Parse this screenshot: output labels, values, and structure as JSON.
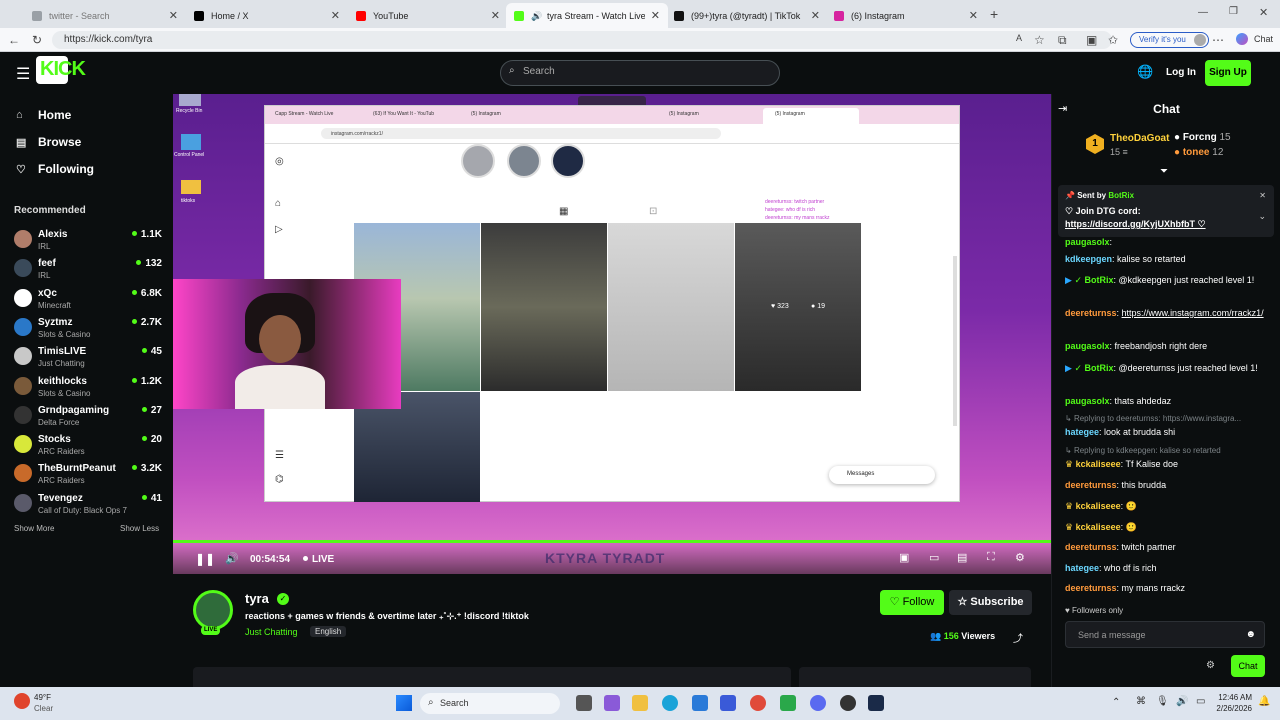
{
  "browser": {
    "tabs": [
      {
        "label": "twitter - Search",
        "color": "#9aa0a6"
      },
      {
        "label": "Home / X",
        "color": "#000000"
      },
      {
        "label": "YouTube",
        "color": "#ff0000"
      },
      {
        "label": "tyra Stream - Watch Live on K",
        "color": "#53fc18"
      },
      {
        "label": "(99+)tyra (@tyradt) | TikTok",
        "color": "#111111"
      },
      {
        "label": "(6) Instagram",
        "color": "#d6249f"
      }
    ],
    "url": "https://kick.com/tyra",
    "verify_label": "Verify it's you",
    "chat_label": "Chat"
  },
  "header": {
    "logo": "KICK",
    "search_placeholder": "Search",
    "login": "Log In",
    "signup": "Sign Up"
  },
  "sidebar": {
    "nav": [
      {
        "label": "Home",
        "icon": "home-icon"
      },
      {
        "label": "Browse",
        "icon": "browse-icon"
      },
      {
        "label": "Following",
        "icon": "heart-icon"
      }
    ],
    "recommended_title": "Recommended",
    "channels": [
      {
        "name": "Alexis",
        "category": "IRL",
        "viewers": "1.1K",
        "color": "#b07d6a"
      },
      {
        "name": "feef",
        "category": "IRL",
        "viewers": "132",
        "color": "#3a4a5a"
      },
      {
        "name": "xQc",
        "category": "Minecraft",
        "viewers": "6.8K",
        "color": "#ffffff"
      },
      {
        "name": "Syztmz",
        "category": "Slots & Casino",
        "viewers": "2.7K",
        "color": "#2a78c8"
      },
      {
        "name": "TimisLIVE",
        "category": "Just Chatting",
        "viewers": "45",
        "color": "#c8c8c8"
      },
      {
        "name": "keithlocks",
        "category": "Slots & Casino",
        "viewers": "1.2K",
        "color": "#7a5a3a"
      },
      {
        "name": "Grndpagaming",
        "category": "Delta Force",
        "viewers": "27",
        "color": "#333333"
      },
      {
        "name": "Stocks",
        "category": "ARC Raiders",
        "viewers": "20",
        "color": "#d8e83a"
      },
      {
        "name": "TheBurntPeanut",
        "category": "ARC Raiders",
        "viewers": "3.2K",
        "color": "#c86a2a"
      },
      {
        "name": "Tevengez",
        "category": "Call of Duty: Black Ops 7",
        "viewers": "41",
        "color": "#5a5a6a"
      }
    ],
    "show_more": "Show More",
    "show_less": "Show Less"
  },
  "video": {
    "time": "00:54:54",
    "live": "LIVE",
    "overlay_text": "KTYRA TYRADT",
    "inner_url": "instagram.com/rrackz1/",
    "inner_tabs": [
      "Capp Stream - Watch Live",
      "(63) If You Want It - YouTub",
      "(5) Instagram",
      "(5) Instagram",
      "(5) Instagram"
    ],
    "inner_active_tab": "(5) Instagram",
    "posts": [
      {
        "likes": "323",
        "comments": "19"
      }
    ],
    "messages_label": "Messages",
    "desktop_icons": [
      "Recycle Bin",
      "Control Panel",
      "tiktoks"
    ],
    "overlay_chat": [
      {
        "user": "deereturnss",
        "text": "twitch partner"
      },
      {
        "user": "hategee",
        "text": "who df is rich"
      },
      {
        "user": "deereturnss",
        "text": "my mans rrackz"
      }
    ]
  },
  "stream_info": {
    "name": "tyra",
    "title": "reactions + games w friends & overtime later ₊˚⊹.⁺ !discord !tiktok",
    "category": "Just Chatting",
    "language": "English",
    "follow": "Follow",
    "subscribe": "Subscribe",
    "viewers": "156",
    "viewers_label": "Viewers",
    "live_badge": "LIVE"
  },
  "chat": {
    "title": "Chat",
    "gifters": [
      {
        "name": "TheoDaGoat",
        "count": "15",
        "rank": "1"
      },
      {
        "name": "Forcng",
        "count": "15"
      },
      {
        "name": "tonee",
        "count": "12"
      }
    ],
    "pinned": {
      "sent_by_label": "Sent by",
      "sender": "BotRix",
      "text": "♡ Join DTG cord:",
      "link": "https://discord.gg/KyjUXhbfbT ♡"
    },
    "messages": [
      {
        "user": "paugasolx",
        "text": "",
        "color": "#53fc18"
      },
      {
        "user": "kdkeepgen",
        "text": "kalise so retarted",
        "color": "#6bd7ff"
      },
      {
        "user": "BotRix",
        "text": "@kdkeepgen just reached level 1!",
        "color": "#53fc18"
      },
      {
        "user": "deereturnss",
        "text": "https://www.instagram.com/rrackz1/",
        "color": "#ff9a3c"
      },
      {
        "user": "paugasolx",
        "text": "freebandjosh right dere",
        "color": "#53fc18"
      },
      {
        "user": "BotRix",
        "text": "@deereturnss just reached level 1!",
        "color": "#53fc18"
      },
      {
        "user": "paugasolx",
        "text": "thats ahdedaz",
        "color": "#53fc18"
      },
      {
        "reply_to": "Replying to deereturnss: https://www.instagra..."
      },
      {
        "user": "hategee",
        "text": "look at brudda shi",
        "color": "#6bd7ff"
      },
      {
        "reply_to": "Replying to kdkeepgen: kalise so retarted"
      },
      {
        "user": "kckaliseee",
        "text": "Tf Kalise doe",
        "color": "#ffd23c"
      },
      {
        "user": "deereturnss",
        "text": "this brudda",
        "color": "#ff9a3c"
      },
      {
        "user": "kckaliseee",
        "text": "",
        "color": "#ffd23c"
      },
      {
        "user": "kckaliseee",
        "text": "",
        "color": "#ffd23c"
      },
      {
        "user": "deereturnss",
        "text": "twitch partner",
        "color": "#ff9a3c"
      },
      {
        "user": "hategee",
        "text": "who df is rich",
        "color": "#6bd7ff"
      },
      {
        "user": "deereturnss",
        "text": "my mans rrackz",
        "color": "#ff9a3c"
      }
    ],
    "followers_only": "Followers only",
    "input_placeholder": "Send a message",
    "send_button": "Chat"
  },
  "taskbar": {
    "weather_temp": "49°F",
    "weather_desc": "Clear",
    "search": "Search",
    "time": "12:46 AM",
    "date": "2/26/2026"
  }
}
